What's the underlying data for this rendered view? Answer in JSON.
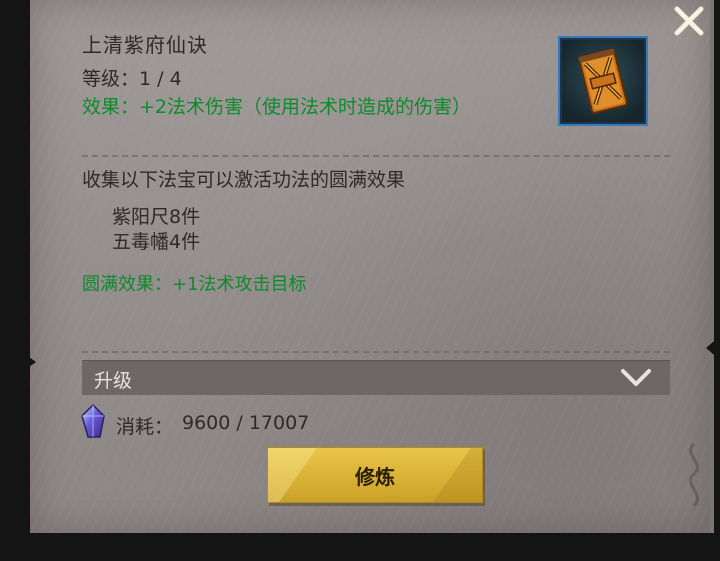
{
  "skill": {
    "title": "上清紫府仙诀",
    "level_text": "等级：1 / 4",
    "effect_text": "效果：+2法术伤害（使用法术时造成的伤害）",
    "icon": "talisman-book-icon"
  },
  "collection": {
    "description": "收集以下法宝可以激活功法的圆满效果",
    "requirements": [
      "紫阳尺8件",
      "五毒幡4件"
    ],
    "full_effect": "圆满效果：+1法术攻击目标"
  },
  "upgrade": {
    "label": "升级",
    "icon": "chevron-down-icon"
  },
  "cost": {
    "label": "消耗：",
    "value": "9600 / 17007",
    "icon": "spirit-crystal-icon"
  },
  "actions": {
    "train_label": "修炼",
    "close_icon": "close-icon"
  },
  "colors": {
    "panel": "#928c8b",
    "effect_green": "#0f8a2a",
    "button_gold": "#d9b236",
    "item_frame_blue": "#3a78b8"
  }
}
